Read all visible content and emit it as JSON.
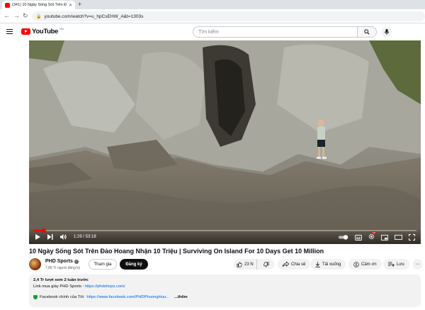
{
  "browser": {
    "tab_title": "(341) 10 Ngày Sống Sót Trên Đả",
    "new_tab": "+",
    "url": "youtube.com/watch?v=u_hpCsEHW_A&t=1303s"
  },
  "header": {
    "logo_text": "YouTube",
    "country_code": "VN",
    "search_placeholder": "Tìm kiếm"
  },
  "player": {
    "timecode": "1:29 / 53:18",
    "progress_fraction": 0.028,
    "settings_badge": "HD"
  },
  "video": {
    "title": "10 Ngày Sống Sót Trên Đảo Hoang Nhận 10 Triệu | Surviving On Island For 10 Days Get 10 Million"
  },
  "channel": {
    "name": "PHD Sports",
    "subscribers": "7,86 Tr người đăng ký",
    "join_label": "Tham gia",
    "subscribe_label": "Đăng ký"
  },
  "actions": {
    "likes": "23 N",
    "share": "Chia sẻ",
    "download": "Tải xuống",
    "thanks": "Cảm ơn",
    "save": "Lưu"
  },
  "description": {
    "views_time": "2,4 Tr lượt xem  2 tuần trước",
    "shop_text": "Link mua giày PHD Sports : ",
    "shop_link": "https://phdshops.com/",
    "fb_text": "Facebook chính của Tôi: ",
    "fb_link": "https://www.facebook.com/PHDPhuongHuu...",
    "more": "...thêm"
  },
  "colors": {
    "brand_red": "#ff0000",
    "link_blue": "#065fd4"
  }
}
